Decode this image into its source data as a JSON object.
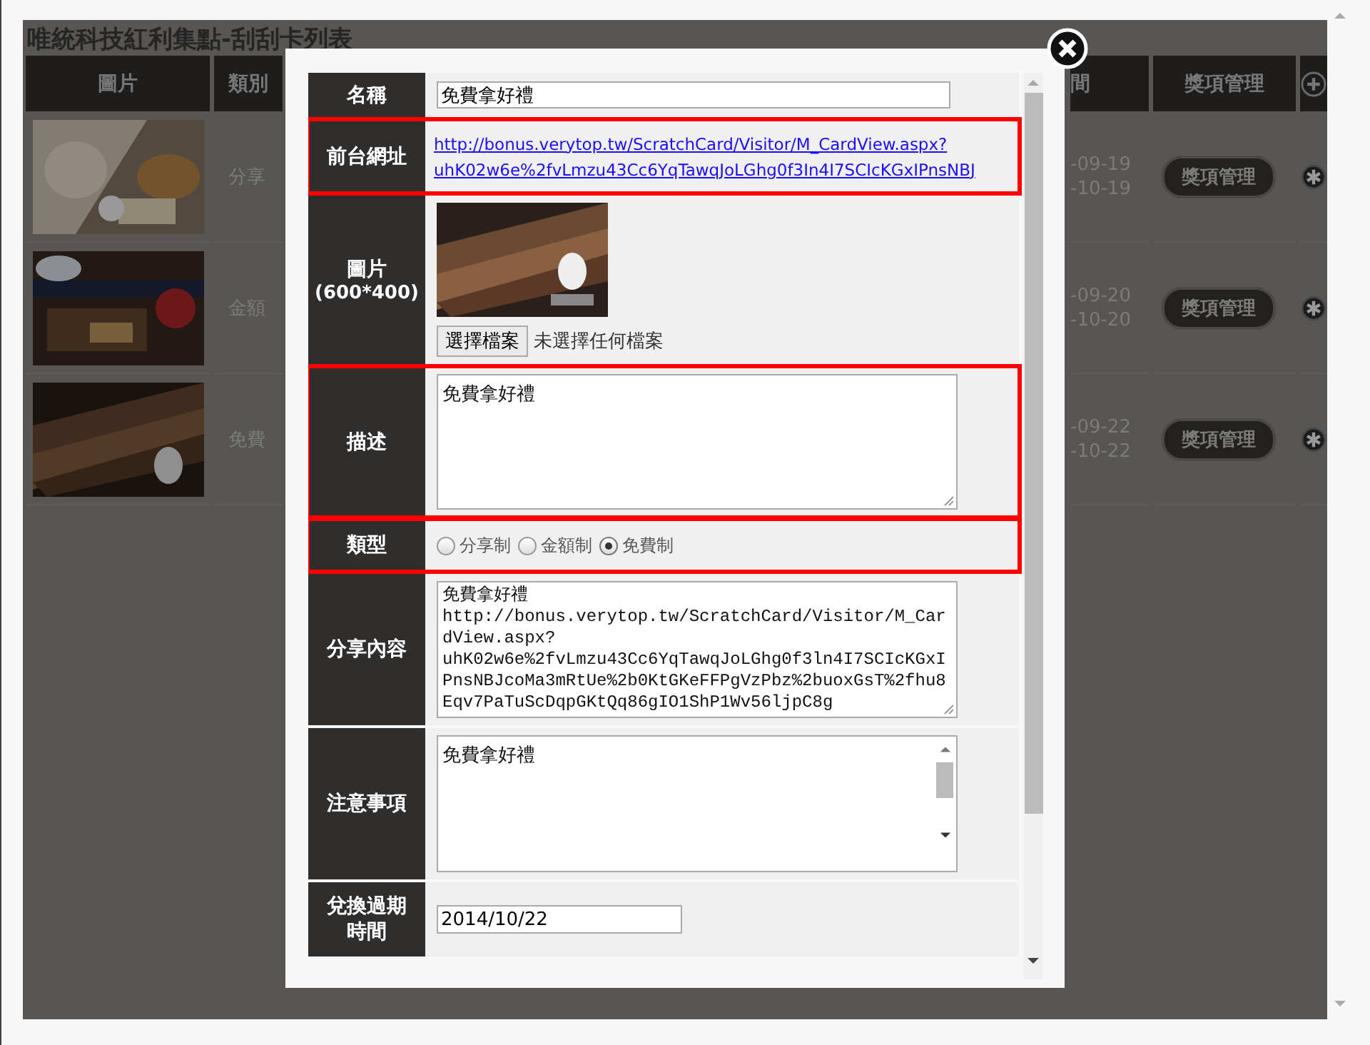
{
  "page_title": "唯統科技紅利集點-刮刮卡列表",
  "table": {
    "columns": [
      "圖片",
      "類別",
      "間",
      "獎項管理"
    ],
    "rows": [
      {
        "picture": {
          "kind": "picture"
        },
        "category": "分享",
        "dates": [
          "-09-19",
          "-10-19"
        ],
        "button": "獎項管理"
      },
      {
        "picture": {
          "kind": "picture"
        },
        "category": "金額",
        "dates": [
          "-09-20",
          "-10-20"
        ],
        "button": "獎項管理"
      },
      {
        "picture": {
          "kind": "picture"
        },
        "category": "免費",
        "dates": [
          "-09-22",
          "-10-22"
        ],
        "button": "獎項管理"
      }
    ]
  },
  "modal": {
    "rows": [
      {
        "kind": "input",
        "label": "名稱",
        "value": "免費拿好禮",
        "highlighted": false
      },
      {
        "kind": "link",
        "label": "前台網址",
        "lines": [
          "http://bonus.verytop.tw/ScratchCard/Visitor/M_CardView.aspx?",
          "uhK02w6e%2fvLmzu43Cc6YqTawqJoLGhg0f3In4I7SCIcKGxIPnsNBJ"
        ],
        "highlighted": true
      },
      {
        "label": "圖片",
        "label_note": "(600*400)",
        "picture": {
          "kind": "picture"
        },
        "file_button": "選擇檔案",
        "file_status": "未選擇任何檔案",
        "highlighted": false
      },
      {
        "kind": "textarea",
        "label": "描述",
        "value": "免費拿好禮",
        "highlighted": true
      },
      {
        "kind": "radio",
        "label": "類型",
        "options": [
          {
            "label": "分享制",
            "selected": false
          },
          {
            "label": "金額制",
            "selected": false
          },
          {
            "label": "免費制",
            "selected": true
          }
        ],
        "highlighted": true
      },
      {
        "kind": "mono",
        "label": "分享內容",
        "lines": [
          "免費拿好禮",
          "http://bonus.verytop.tw/ScratchCard/Visitor/M_Car",
          "dView.aspx?",
          "uhK02w6e%2fvLmzu43Cc6YqTawqJoLGhg0f3ln4I7SCIcKGxI",
          "PnsNBJcoMa3mRtUe%2b0KtGKeFFPgVzPbz%2buoxGsT%2fhu8",
          "Eqv7PaTuScDqpGKtQq86gIO1ShP1Wv56ljpC8g"
        ],
        "highlighted": false
      },
      {
        "kind": "scrolltext",
        "label": "注意事項",
        "value": "免費拿好禮",
        "highlighted": false
      },
      {
        "kind": "date",
        "label": "兌換過期時間",
        "value": "2014/10/22",
        "highlighted": false
      }
    ]
  }
}
